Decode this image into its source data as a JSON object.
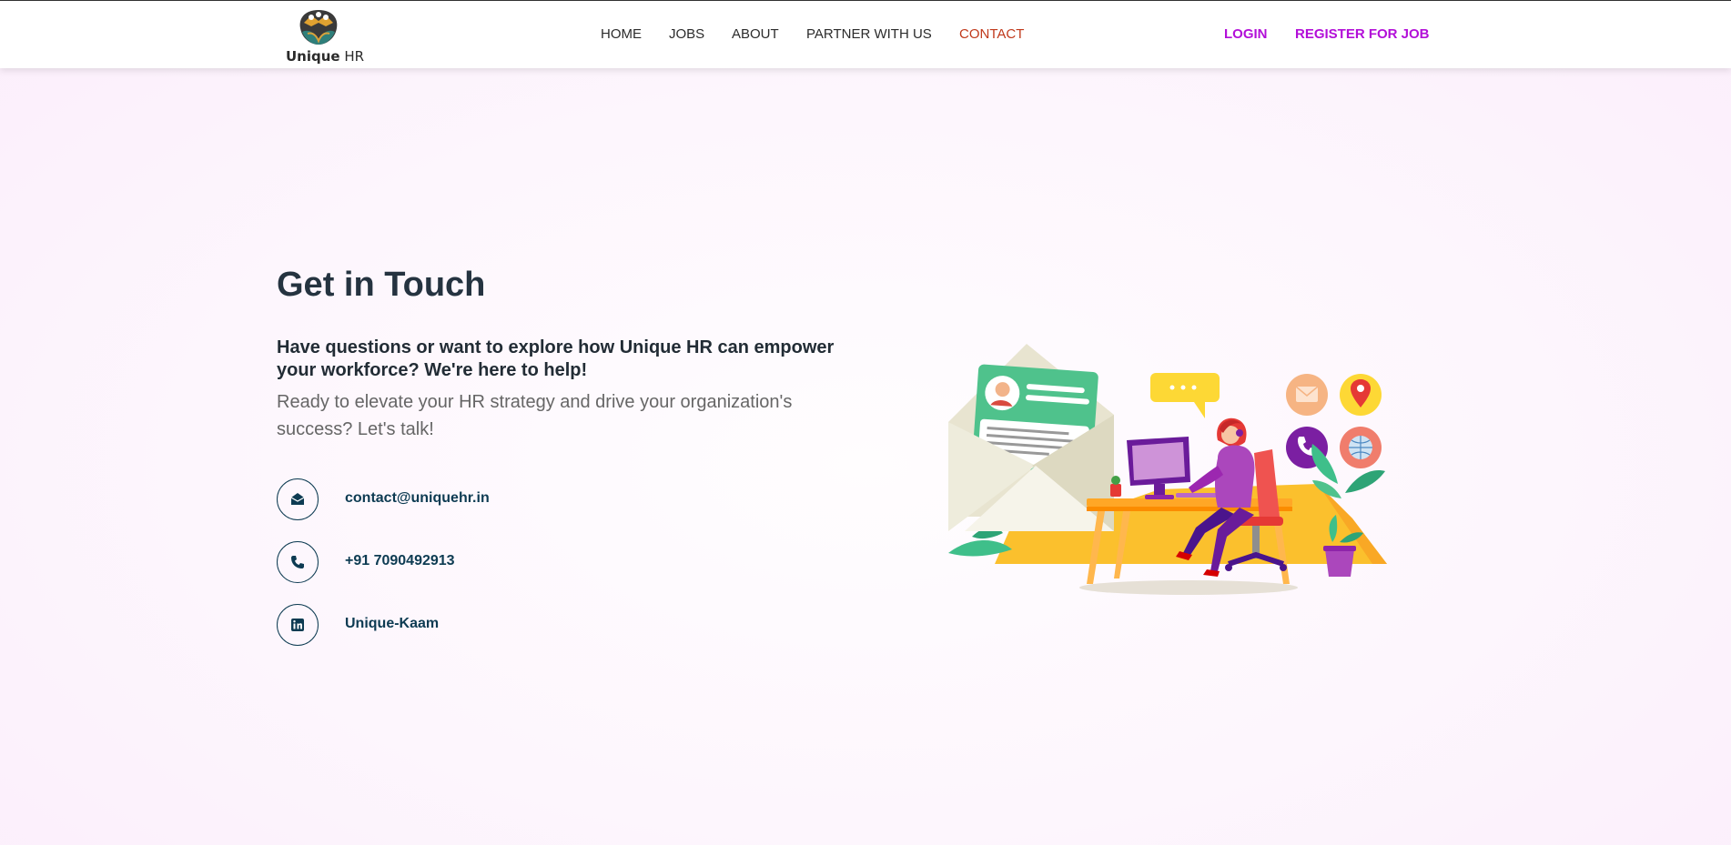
{
  "brand": {
    "name_bold": "Unique",
    "name_regular": "HR"
  },
  "nav": {
    "items": [
      {
        "label": "HOME"
      },
      {
        "label": "JOBS"
      },
      {
        "label": "ABOUT"
      },
      {
        "label": "PARTNER WITH US"
      },
      {
        "label": "CONTACT",
        "active": true
      }
    ],
    "login": "LOGIN",
    "register": "REGISTER FOR JOB"
  },
  "main": {
    "title": "Get in Touch",
    "lead": "Have questions or want to explore how Unique HR can empower your workforce? We're here to help!",
    "sub": "Ready to elevate your HR strategy and drive your organization's success? Let's talk!",
    "contacts": [
      {
        "icon": "envelope-icon",
        "label": "contact@uniquehr.in"
      },
      {
        "icon": "phone-icon",
        "label": "+91 7090492913"
      },
      {
        "icon": "linkedin-icon",
        "label": "Unique-Kaam"
      }
    ]
  },
  "colors": {
    "nav_active": "#c0391b",
    "auth_links": "#b20fd8",
    "contact_accent": "#0d3b52",
    "heading": "#253340"
  }
}
